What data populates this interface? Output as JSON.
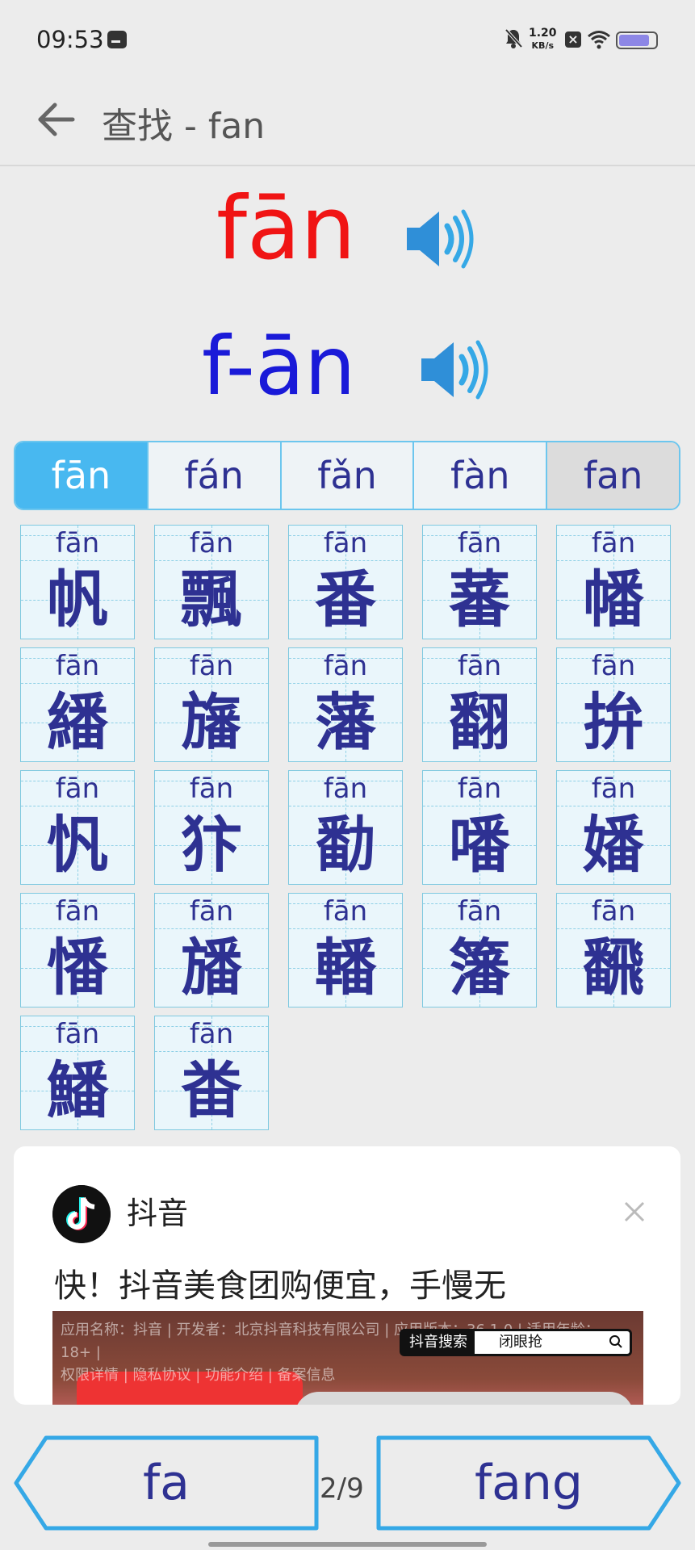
{
  "status_bar": {
    "time": "09:53",
    "speed_value": "1.20",
    "speed_unit": "KB/s",
    "battery_level": 0.85,
    "battery_color": "#8d87e6"
  },
  "header": {
    "title": "查找 - fan"
  },
  "pinyin": {
    "main": "fān",
    "split": "f-ān",
    "main_color": "#f01414",
    "split_color": "#1a1ad8"
  },
  "tabs": [
    {
      "label": "fān"
    },
    {
      "label": "fán"
    },
    {
      "label": "fǎn"
    },
    {
      "label": "fàn"
    },
    {
      "label": "fan"
    }
  ],
  "characters": [
    {
      "pinyin": "fān",
      "char": "帆"
    },
    {
      "pinyin": "fān",
      "char": "飄"
    },
    {
      "pinyin": "fān",
      "char": "番"
    },
    {
      "pinyin": "fān",
      "char": "蕃"
    },
    {
      "pinyin": "fān",
      "char": "幡"
    },
    {
      "pinyin": "fān",
      "char": "繙"
    },
    {
      "pinyin": "fān",
      "char": "旛"
    },
    {
      "pinyin": "fān",
      "char": "藩"
    },
    {
      "pinyin": "fān",
      "char": "翻"
    },
    {
      "pinyin": "fān",
      "char": "拚"
    },
    {
      "pinyin": "fān",
      "char": "忛"
    },
    {
      "pinyin": "fān",
      "char": "犿"
    },
    {
      "pinyin": "fān",
      "char": "勫"
    },
    {
      "pinyin": "fān",
      "char": "噃"
    },
    {
      "pinyin": "fān",
      "char": "嬏"
    },
    {
      "pinyin": "fān",
      "char": "憣"
    },
    {
      "pinyin": "fān",
      "char": "旙"
    },
    {
      "pinyin": "fān",
      "char": "轓"
    },
    {
      "pinyin": "fān",
      "char": "籓"
    },
    {
      "pinyin": "fān",
      "char": "飜"
    },
    {
      "pinyin": "fān",
      "char": "鱕"
    },
    {
      "pinyin": "fān",
      "char": "畨"
    }
  ],
  "ad": {
    "app_name": "抖音",
    "headline": "快！抖音美食团购便宜，手慢无",
    "info_line1": "应用名称：抖音 | 开发者：北京抖音科技有限公司 | 应用版本：36.1.0 | 适用年龄：18+ |",
    "info_line2": "权限详情 | 隐私协议 | 功能介绍 | 备案信息",
    "search_label": "抖音搜索",
    "search_text": "闭眼抢"
  },
  "bottom_nav": {
    "prev_label": "fa",
    "page": "2/9",
    "next_label": "fang"
  }
}
